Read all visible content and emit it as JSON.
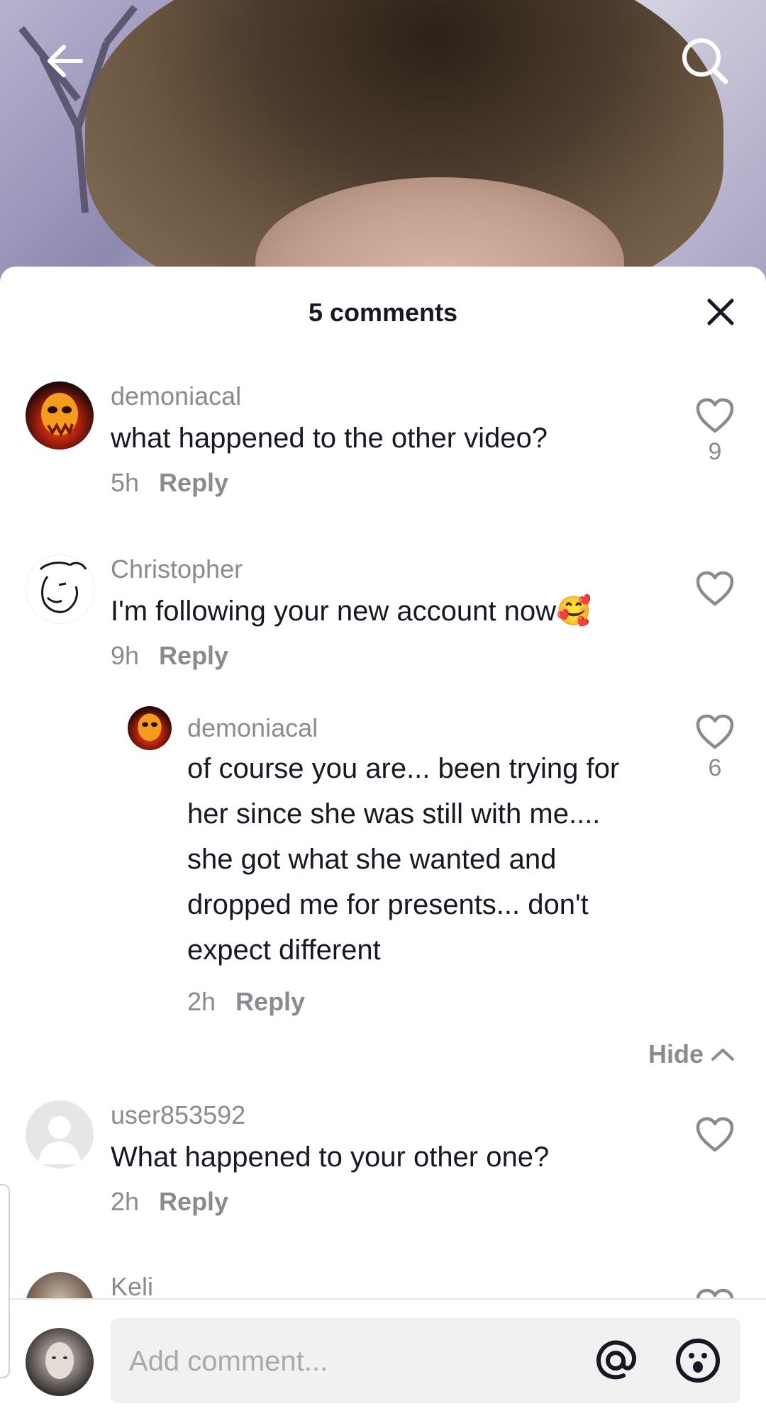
{
  "sheet": {
    "title": "5 comments"
  },
  "comments": [
    {
      "username": "demoniacal",
      "text": "what happened to the other video?",
      "time": "5h",
      "reply_label": "Reply",
      "likes": "9"
    },
    {
      "username": "Christopher",
      "text": "I'm following your new account now🥰",
      "time": "9h",
      "reply_label": "Reply",
      "likes": ""
    },
    {
      "username": "demoniacal",
      "text": "of course you are... been trying for her since she was still with me.... she got what she wanted and dropped me for presents... don't expect different",
      "time": "2h",
      "reply_label": "Reply",
      "likes": "6"
    },
    {
      "username": "user853592",
      "text": "What happened to your other one?",
      "time": "2h",
      "reply_label": "Reply",
      "likes": ""
    },
    {
      "username": "Keli",
      "text": "",
      "time": "",
      "reply_label": "",
      "likes": ""
    }
  ],
  "replies_toggle": {
    "label": "Hide"
  },
  "composer": {
    "placeholder": "Add comment..."
  },
  "icons": {
    "back": "arrow-left-icon",
    "search": "search-icon",
    "close": "close-icon",
    "like": "heart-outline-icon",
    "mention": "at-sign-icon",
    "emoji": "emoji-icon",
    "collapse": "chevron-up-icon"
  },
  "colors": {
    "text_primary": "#161823",
    "text_secondary": "#8a8b91",
    "input_bg": "#f1f1f2"
  }
}
